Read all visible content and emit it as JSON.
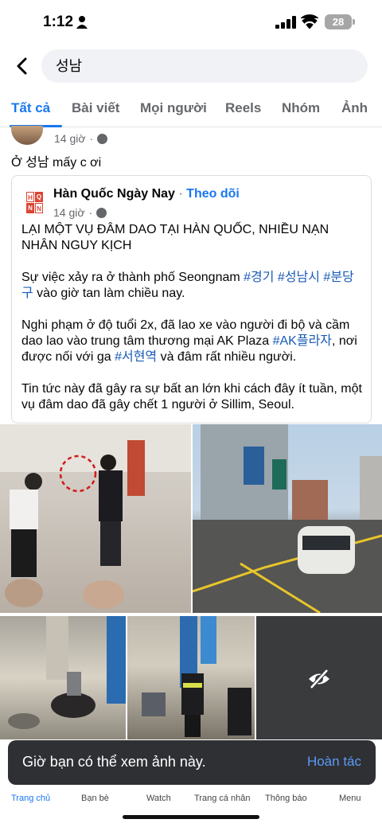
{
  "status": {
    "time": "1:12",
    "battery": "28"
  },
  "search": {
    "value": "성남"
  },
  "tabs": [
    {
      "label": "Tất cả",
      "active": true
    },
    {
      "label": "Bài viết"
    },
    {
      "label": "Mọi người"
    },
    {
      "label": "Reels"
    },
    {
      "label": "Nhóm"
    },
    {
      "label": "Ảnh"
    }
  ],
  "post": {
    "time": "14 giờ",
    "text": "Ở 성남 mấy c ơi",
    "shared": {
      "page_name": "Hàn Quốc Ngày Nay",
      "follow": "Theo dõi",
      "time": "14 giờ",
      "p1": "LẠI MỘT VỤ ĐÂM DAO TẠI HÀN QUỐC, NHIỀU NẠN NHÂN NGUY KỊCH",
      "p2_text": "Sự việc xảy ra ở thành phố Seongnam ",
      "p2_tags": "#경기 #성남시 #분당구",
      "p2_tail": " vào giờ tan làm chiều nay.",
      "p3_a": "Nghi phạm ở độ tuổi 2x, đã lao xe vào người đi bộ và cầm dao lao vào trung tâm thương mại AK Plaza ",
      "p3_tag1": "#AK플라자",
      "p3_b": ", nơi được nối với ga ",
      "p3_tag2": "#서현역",
      "p3_c": " và đâm rất nhiều người.",
      "p4": "Tin tức này đã gây ra sự bất an lớn khi cách đây ít tuần, một vụ đâm dao đã gây chết 1 người ở Sillim, Seoul."
    }
  },
  "toast": {
    "text": "Giờ bạn có thể xem ảnh này.",
    "action": "Hoàn tác"
  },
  "bottom_nav": [
    {
      "label": "Trang chủ",
      "active": true
    },
    {
      "label": "Bạn bè"
    },
    {
      "label": "Watch"
    },
    {
      "label": "Trang cá nhân"
    },
    {
      "label": "Thông báo"
    },
    {
      "label": "Menu"
    }
  ],
  "colors": {
    "accent": "#1877f2",
    "toast_bg": "#2f3034"
  }
}
